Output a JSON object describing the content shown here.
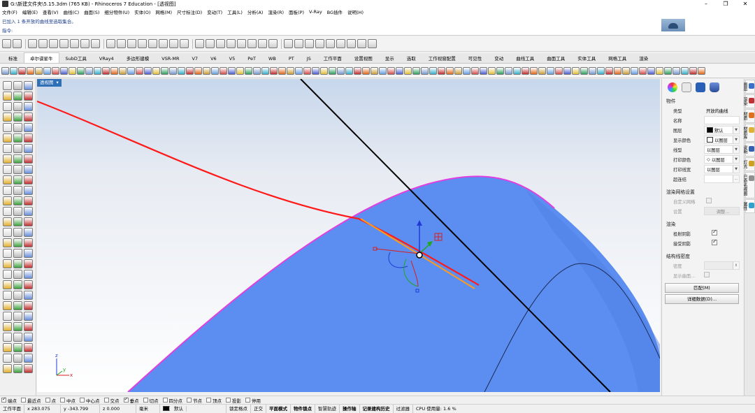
{
  "window": {
    "title": "G:\\新建文件夹\\5.15.3dm (765 KB) - Rhinoceros 7 Education - [透视图]"
  },
  "menu": [
    "文件(F)",
    "编辑(E)",
    "查看(V)",
    "曲线(C)",
    "曲面(S)",
    "细分物件(U)",
    "实体(O)",
    "网格(M)",
    "尺寸标注(D)",
    "变动(T)",
    "工具(L)",
    "分析(A)",
    "渲染(R)",
    "面板(P)",
    "V-Ray",
    "BG插件",
    "说明(H)"
  ],
  "command": {
    "history": "已加入 1 条开放的曲线至选取集合。",
    "prompt": "指令:",
    "value": ""
  },
  "tabs": [
    "标准",
    "卓尔谟星牛",
    "SubD工具",
    "VRay4",
    "多边形建模",
    "VSR-MR",
    "V7",
    "V6",
    "V5",
    "PeT",
    "WB",
    "PT",
    "JS",
    "工作平面",
    "设置视图",
    "显示",
    "选取",
    "工作视窗配置",
    "可见性",
    "变动",
    "曲线工具",
    "曲面工具",
    "实体工具",
    "网格工具",
    "渲染"
  ],
  "active_tab": "卓尔谟星牛",
  "viewport": {
    "label": "透视图",
    "axes": {
      "x": "x",
      "y": "y",
      "z": "z"
    }
  },
  "properties": {
    "section_object": "物件",
    "rows": [
      {
        "key": "类型",
        "value": "开放的曲线",
        "kind": "text"
      },
      {
        "key": "名称",
        "value": "",
        "kind": "input"
      },
      {
        "key": "图层",
        "value": "默认",
        "kind": "select",
        "swatch": "#000000"
      },
      {
        "key": "显示颜色",
        "value": "以图层",
        "kind": "select",
        "swatch": "#ffffff"
      },
      {
        "key": "线型",
        "value": "以图层",
        "kind": "select"
      },
      {
        "key": "打印颜色",
        "value": "以图层",
        "kind": "select",
        "diamond": true
      },
      {
        "key": "打印线宽",
        "value": "以图层",
        "kind": "select"
      },
      {
        "key": "超连结",
        "value": "",
        "kind": "input-btn"
      }
    ],
    "section_mesh": "渲染网格设置",
    "custom_mesh": "自定义网格",
    "settings": "设置",
    "adjust": "调整...",
    "section_render": "渲染",
    "cast_shadows": "投射阴影",
    "receive_shadows": "接受阴影",
    "section_isocurve": "结构线密度",
    "density": "密度",
    "show_surface": "显示曲面...",
    "match_button": "匹配(M)",
    "details_button": "详细数据(D)..."
  },
  "side_tabs": [
    "图层",
    "渲染",
    "材质",
    "材质库",
    "说明",
    "灯光",
    "已命名视图",
    "属性"
  ],
  "osnap": [
    {
      "label": "端点",
      "on": true
    },
    {
      "label": "最近点",
      "on": false
    },
    {
      "label": "点",
      "on": false
    },
    {
      "label": "中点",
      "on": false
    },
    {
      "label": "中心点",
      "on": false
    },
    {
      "label": "交点",
      "on": false
    },
    {
      "label": "垂点",
      "on": true
    },
    {
      "label": "切点",
      "on": false
    },
    {
      "label": "四分点",
      "on": false
    },
    {
      "label": "节点",
      "on": false
    },
    {
      "label": "顶点",
      "on": false
    },
    {
      "label": "投影",
      "on": false
    },
    {
      "label": "停用",
      "on": false
    }
  ],
  "status": {
    "cplane": "工作平面",
    "x": "x 283.075",
    "y": "y -343.799",
    "z": "z 0.000",
    "units": "毫米",
    "layer": "默认",
    "items": [
      "锁定格点",
      "正交",
      "平面模式",
      "物件锁点",
      "智慧轨迹",
      "操作轴",
      "记录建构历史",
      "过滤器"
    ],
    "bold_items": [
      "平面模式",
      "物件锁点",
      "操作轴",
      "记录建构历史"
    ],
    "cpu": "CPU 使用量: 1.6 %"
  },
  "colors": {
    "surface": "#5b8ef0",
    "edge": "#e040e0",
    "red_curve": "#ff1a1a",
    "orange_curve": "#ff9a1a",
    "selection": "#2e6fb8"
  }
}
